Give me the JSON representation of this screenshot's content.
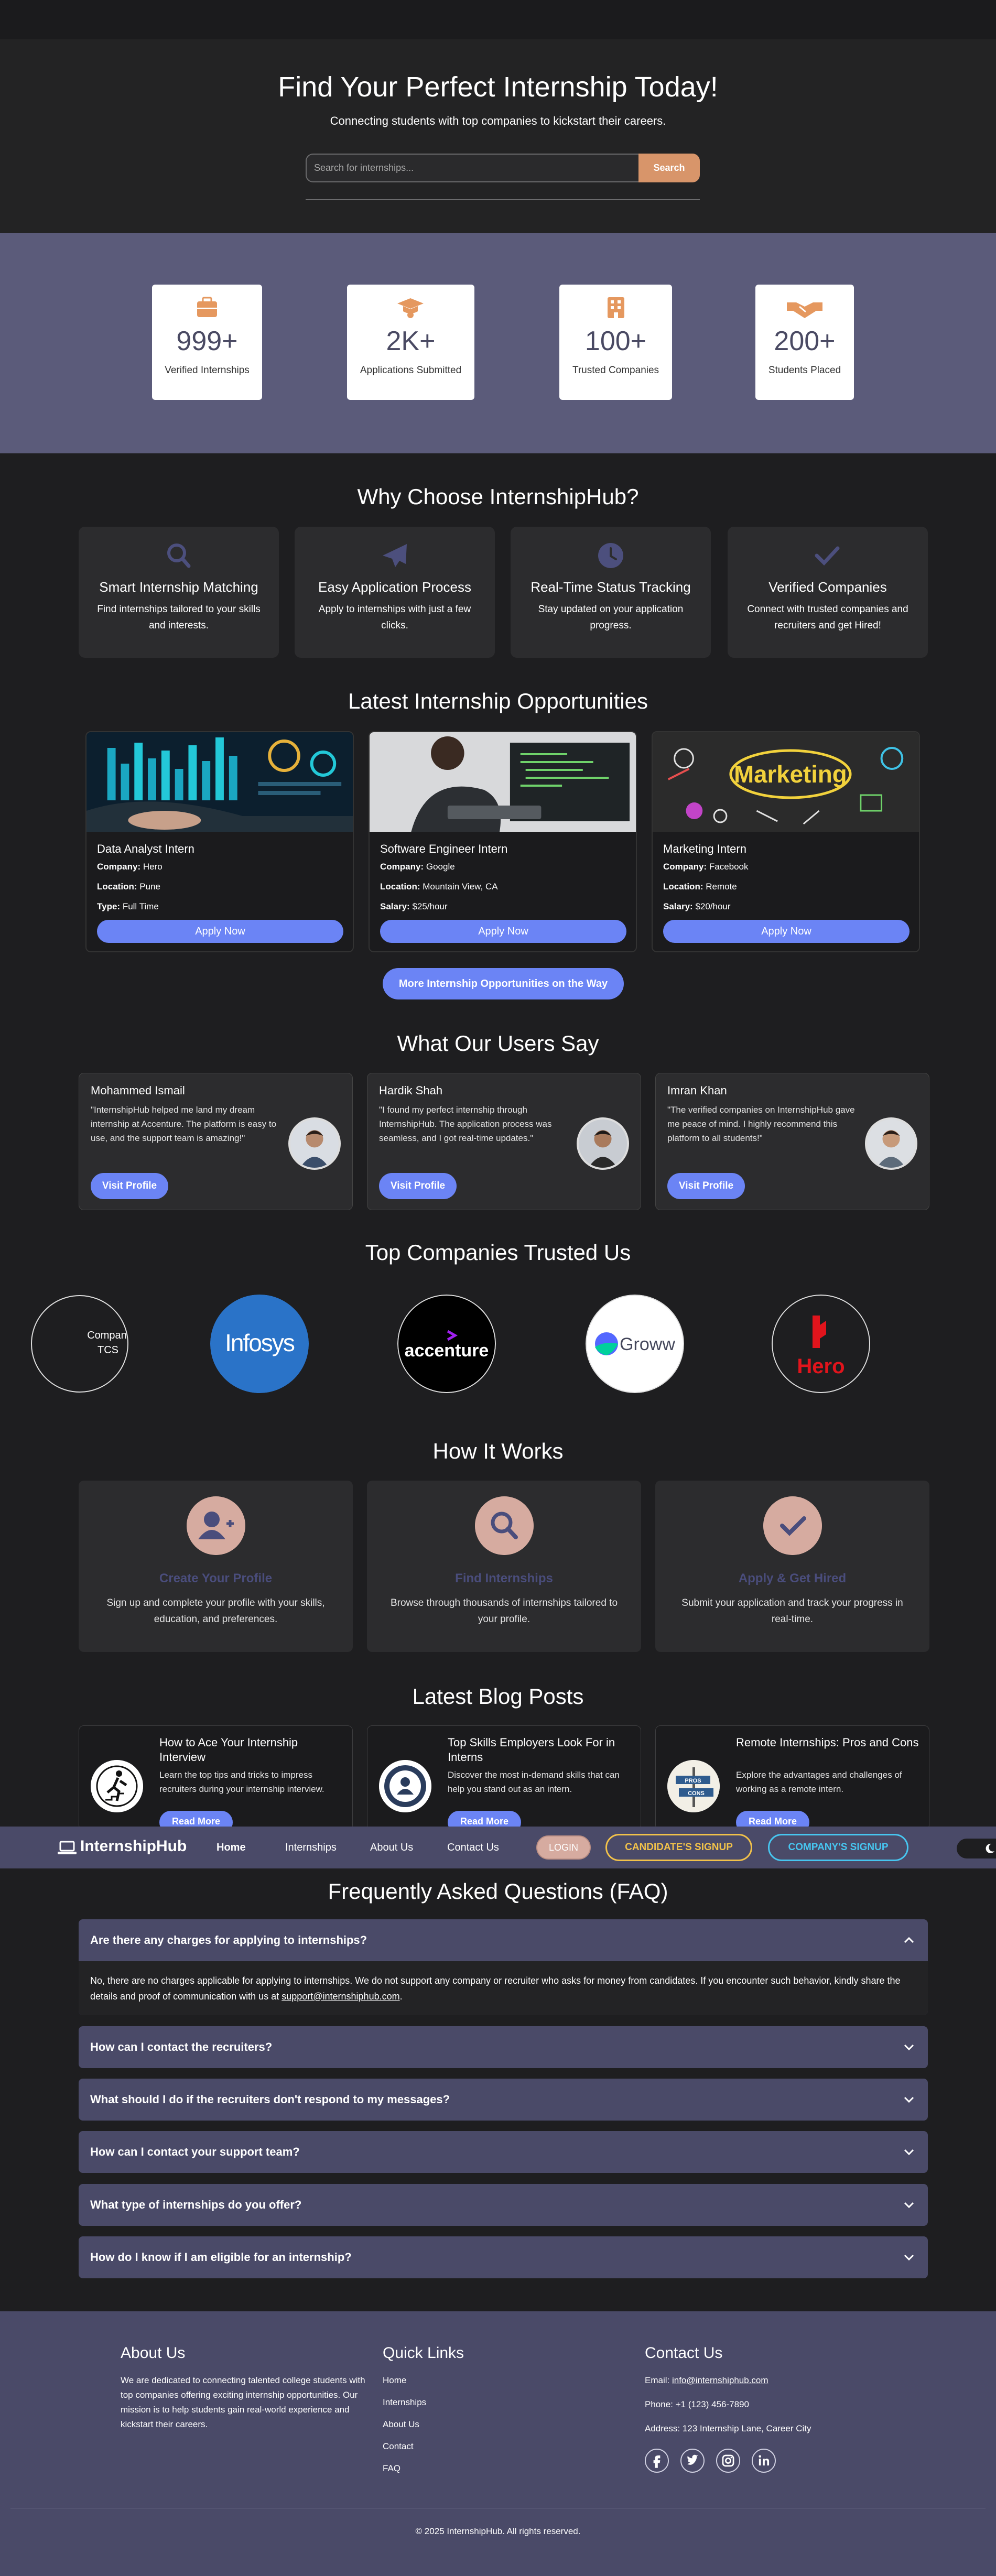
{
  "hero": {
    "title": "Find Your Perfect Internship Today!",
    "subtitle": "Connecting students with top companies to kickstart their careers.",
    "search_placeholder": "Search for internships...",
    "search_button": "Search"
  },
  "stats": [
    {
      "icon": "briefcase-icon",
      "value": "999+",
      "label": "Verified Internships"
    },
    {
      "icon": "graduation-cap-icon",
      "value": "2K+",
      "label": "Applications Submitted"
    },
    {
      "icon": "building-icon",
      "value": "100+",
      "label": "Trusted Companies"
    },
    {
      "icon": "handshake-icon",
      "value": "200+",
      "label": "Students Placed"
    }
  ],
  "why": {
    "title": "Why Choose InternshipHub?",
    "items": [
      {
        "icon": "search-icon",
        "title": "Smart Internship Matching",
        "desc": "Find internships tailored to your skills and interests."
      },
      {
        "icon": "paper-plane-icon",
        "title": "Easy Application Process",
        "desc": "Apply to internships with just a few clicks."
      },
      {
        "icon": "clock-icon",
        "title": "Real-Time Status Tracking",
        "desc": "Stay updated on your application progress."
      },
      {
        "icon": "check-icon",
        "title": "Verified Companies",
        "desc": "Connect with trusted companies and recruiters and get Hired!"
      }
    ]
  },
  "jobs": {
    "title": "Latest Internship Opportunities",
    "items": [
      {
        "title": "Data Analyst Intern",
        "l1k": "Company:",
        "l1v": "Hero",
        "l2k": "Location:",
        "l2v": "Pune",
        "l3k": "Type:",
        "l3v": "Full Time",
        "button": "Apply Now"
      },
      {
        "title": "Software Engineer Intern",
        "l1k": "Company:",
        "l1v": "Google",
        "l2k": "Location:",
        "l2v": "Mountain View, CA",
        "l3k": "Salary:",
        "l3v": "$25/hour",
        "button": "Apply Now"
      },
      {
        "title": "Marketing Intern",
        "l1k": "Company:",
        "l1v": "Facebook",
        "l2k": "Location:",
        "l2v": "Remote",
        "l3k": "Salary:",
        "l3v": "$20/hour",
        "button": "Apply Now"
      }
    ],
    "marketing_word": "Marketing",
    "more_button": "More Internship Opportunities on the Way"
  },
  "testimonials": {
    "title": "What Our Users Say",
    "items": [
      {
        "name": "Mohammed Ismail",
        "quote": "\"InternshipHub helped me land my dream internship at Accenture. The platform is easy to use, and the support team is amazing!\"",
        "button": "Visit Profile"
      },
      {
        "name": "Hardik Shah",
        "quote": "\"I found my perfect internship through InternshipHub. The application process was seamless, and I got real-time updates.\"",
        "button": "Visit Profile"
      },
      {
        "name": "Imran Khan",
        "quote": "\"The verified companies on InternshipHub gave me peace of mind. I highly recommend this platform to all students!\"",
        "button": "Visit Profile"
      }
    ]
  },
  "companies": {
    "title": "Top Companies Trusted Us",
    "partial_line1": "Compan",
    "partial_line2": "TCS",
    "infosys": "Infosys",
    "accenture": "accenture",
    "groww": "Groww",
    "hero": "Hero"
  },
  "how": {
    "title": "How It Works",
    "items": [
      {
        "icon": "add-user-icon",
        "title": "Create Your Profile",
        "desc": "Sign up and complete your profile with your skills, education, and preferences."
      },
      {
        "icon": "search-icon",
        "title": "Find Internships",
        "desc": "Browse through thousands of internships tailored to your profile."
      },
      {
        "icon": "check-icon",
        "title": "Apply & Get Hired",
        "desc": "Submit your application and track your progress in real-time."
      }
    ]
  },
  "blog": {
    "title": "Latest Blog Posts",
    "items": [
      {
        "title": "How to Ace Your Internship Interview",
        "desc": "Learn the top tips and tricks to impress recruiters during your internship interview.",
        "button": "Read More"
      },
      {
        "title": "Top Skills Employers Look For in Interns",
        "desc": "Discover the most in-demand skills that can help you stand out as an intern.",
        "button": "Read More"
      },
      {
        "title": "Remote Internships: Pros and Cons",
        "desc": "Explore the advantages and challenges of working as a remote intern.",
        "button": "Read More"
      }
    ],
    "pros": "PROS",
    "cons": "CONS"
  },
  "nav": {
    "brand": "InternshipHub",
    "links": [
      "Home",
      "Internships",
      "About Us",
      "Contact Us"
    ],
    "login": "LOGIN",
    "candidate_signup": "CANDIDATE'S SIGNUP",
    "company_signup": "COMPANY'S SIGNUP"
  },
  "faq": {
    "title": "Frequently Asked Questions (FAQ)",
    "items": [
      {
        "q": "Are there any charges for applying to internships?",
        "expanded": true
      },
      {
        "q": "How can I contact the recruiters?",
        "expanded": false
      },
      {
        "q": "What should I do if the recruiters don't respond to my messages?",
        "expanded": false
      },
      {
        "q": "How can I contact your support team?",
        "expanded": false
      },
      {
        "q": "What type of internships do you offer?",
        "expanded": false
      },
      {
        "q": "How do I know if I am eligible for an internship?",
        "expanded": false
      }
    ],
    "answer_text": "No, there are no charges applicable for applying to internships. We do not support any company or recruiter who asks for money from candidates. If you encounter such behavior, kindly share the details and proof of communication with us at ",
    "answer_email": "support@internshiphub.com",
    "answer_end": "."
  },
  "footer": {
    "about_title": "About Us",
    "about_text": "We are dedicated to connecting talented college students with top companies offering exciting internship opportunities. Our mission is to help students gain real-world experience and kickstart their careers.",
    "links_title": "Quick Links",
    "links": [
      "Home",
      "Internships",
      "About Us",
      "Contact",
      "FAQ"
    ],
    "contact_title": "Contact Us",
    "email_label": "Email: ",
    "email": "info@internshiphub.com",
    "phone": "Phone: +1 (123) 456-7890",
    "address": "Address: 123 Internship Lane, Career City",
    "social": [
      "facebook-icon",
      "twitter-icon",
      "instagram-icon",
      "linkedin-icon"
    ],
    "copyright": "© 2025 InternshipHub. All rights reserved."
  },
  "colors": {
    "accent": "#6b84f5",
    "orange": "#e5985f",
    "stats_bg": "#5b5b7a",
    "nav_bg": "#4a4a68",
    "signup_yellow": "#f2c24a",
    "signup_blue": "#47c6f0"
  }
}
